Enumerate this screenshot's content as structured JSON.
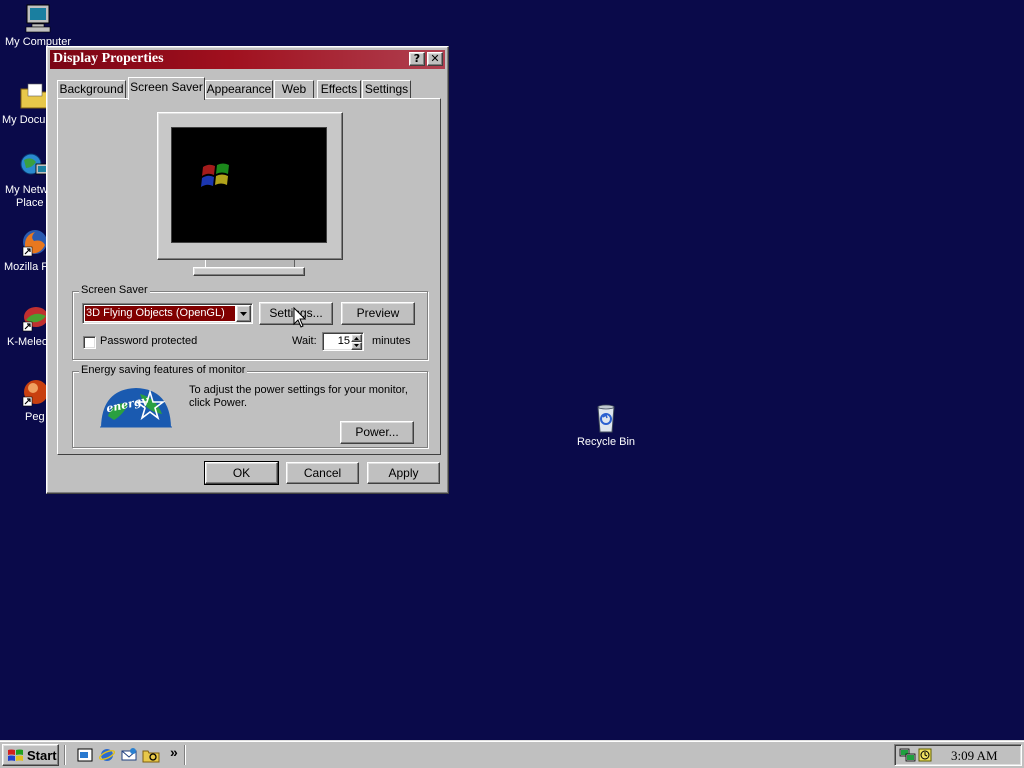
{
  "desktop": {
    "icons": [
      {
        "label": "My Computer",
        "icon": "my-computer-icon"
      },
      {
        "label": "My Docu",
        "icon": "my-documents-icon"
      },
      {
        "label": "My Netw",
        "label2": "Place",
        "icon": "network-places-icon"
      },
      {
        "label": "Mozilla F",
        "icon": "firefox-icon"
      },
      {
        "label": "K-Meleo",
        "icon": "k-meleon-icon"
      },
      {
        "label": "Peg",
        "icon": "pegasus-icon"
      },
      {
        "label": "Recycle Bin",
        "icon": "recycle-bin-icon"
      }
    ]
  },
  "window": {
    "title": "Display Properties",
    "help_glyph": "?",
    "close_glyph": "✕",
    "tabs": [
      {
        "label": "Background"
      },
      {
        "label": "Screen Saver",
        "active": true
      },
      {
        "label": "Appearance"
      },
      {
        "label": "Web"
      },
      {
        "label": "Effects"
      },
      {
        "label": "Settings"
      }
    ],
    "screen_saver": {
      "group_label": "Screen Saver",
      "selected": "3D Flying Objects (OpenGL)",
      "settings_label": "Settings...",
      "preview_label": "Preview",
      "password_label": "Password protected",
      "password_checked": false,
      "wait_label": "Wait:",
      "wait_value": "15",
      "minutes_label": "minutes"
    },
    "energy": {
      "group_label": "Energy saving features of monitor",
      "text": "To adjust the power settings for your monitor, click Power.",
      "logo_text": "energy",
      "power_label": "Power..."
    },
    "buttons": {
      "ok": "OK",
      "cancel": "Cancel",
      "apply": "Apply"
    }
  },
  "taskbar": {
    "start_label": "Start",
    "chevron": "»",
    "clock": "3:09 AM"
  },
  "colors": {
    "desktop": "#0a0a4a",
    "titlebar": "#7a0414",
    "selection": "#800000",
    "face": "#c0c0c0"
  }
}
